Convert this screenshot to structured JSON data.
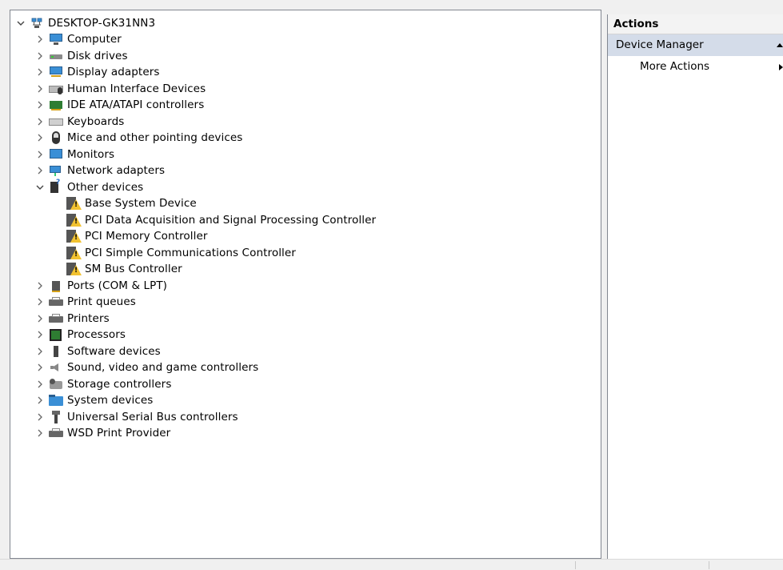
{
  "tree": {
    "root_label": "DESKTOP-GK31NN3",
    "items": [
      {
        "label": "Computer",
        "icon": "computer-icon",
        "expanded": false
      },
      {
        "label": "Disk drives",
        "icon": "disk-drive-icon",
        "expanded": false
      },
      {
        "label": "Display adapters",
        "icon": "display-adapter-icon",
        "expanded": false
      },
      {
        "label": "Human Interface Devices",
        "icon": "hid-icon",
        "expanded": false
      },
      {
        "label": "IDE ATA/ATAPI controllers",
        "icon": "ide-controller-icon",
        "expanded": false
      },
      {
        "label": "Keyboards",
        "icon": "keyboard-icon",
        "expanded": false
      },
      {
        "label": "Mice and other pointing devices",
        "icon": "mouse-icon",
        "expanded": false
      },
      {
        "label": "Monitors",
        "icon": "monitor-icon",
        "expanded": false
      },
      {
        "label": "Network adapters",
        "icon": "network-adapter-icon",
        "expanded": false
      },
      {
        "label": "Other devices",
        "icon": "unknown-device-icon",
        "expanded": true
      },
      {
        "label": "Ports (COM & LPT)",
        "icon": "port-icon",
        "expanded": false
      },
      {
        "label": "Print queues",
        "icon": "printer-icon",
        "expanded": false
      },
      {
        "label": "Printers",
        "icon": "printer-icon",
        "expanded": false
      },
      {
        "label": "Processors",
        "icon": "processor-icon",
        "expanded": false
      },
      {
        "label": "Software devices",
        "icon": "software-device-icon",
        "expanded": false
      },
      {
        "label": "Sound, video and game controllers",
        "icon": "speaker-icon",
        "expanded": false
      },
      {
        "label": "Storage controllers",
        "icon": "storage-controller-icon",
        "expanded": false
      },
      {
        "label": "System devices",
        "icon": "system-folder-icon",
        "expanded": false
      },
      {
        "label": "Universal Serial Bus controllers",
        "icon": "usb-icon",
        "expanded": false
      },
      {
        "label": "WSD Print Provider",
        "icon": "printer-icon",
        "expanded": false
      }
    ],
    "other_devices": [
      {
        "label": "Base System Device",
        "icon": "warning-device-icon"
      },
      {
        "label": "PCI Data Acquisition and Signal Processing Controller",
        "icon": "warning-device-icon"
      },
      {
        "label": "PCI Memory Controller",
        "icon": "warning-device-icon"
      },
      {
        "label": "PCI Simple Communications Controller",
        "icon": "warning-device-icon"
      },
      {
        "label": "SM Bus Controller",
        "icon": "warning-device-icon"
      }
    ]
  },
  "actions": {
    "header": "Actions",
    "section": "Device Manager",
    "more_actions": "More Actions"
  },
  "colors": {
    "selection_bg": "#d4dce9",
    "warning": "#f2c230",
    "accent_blue": "#3a8fd6"
  }
}
